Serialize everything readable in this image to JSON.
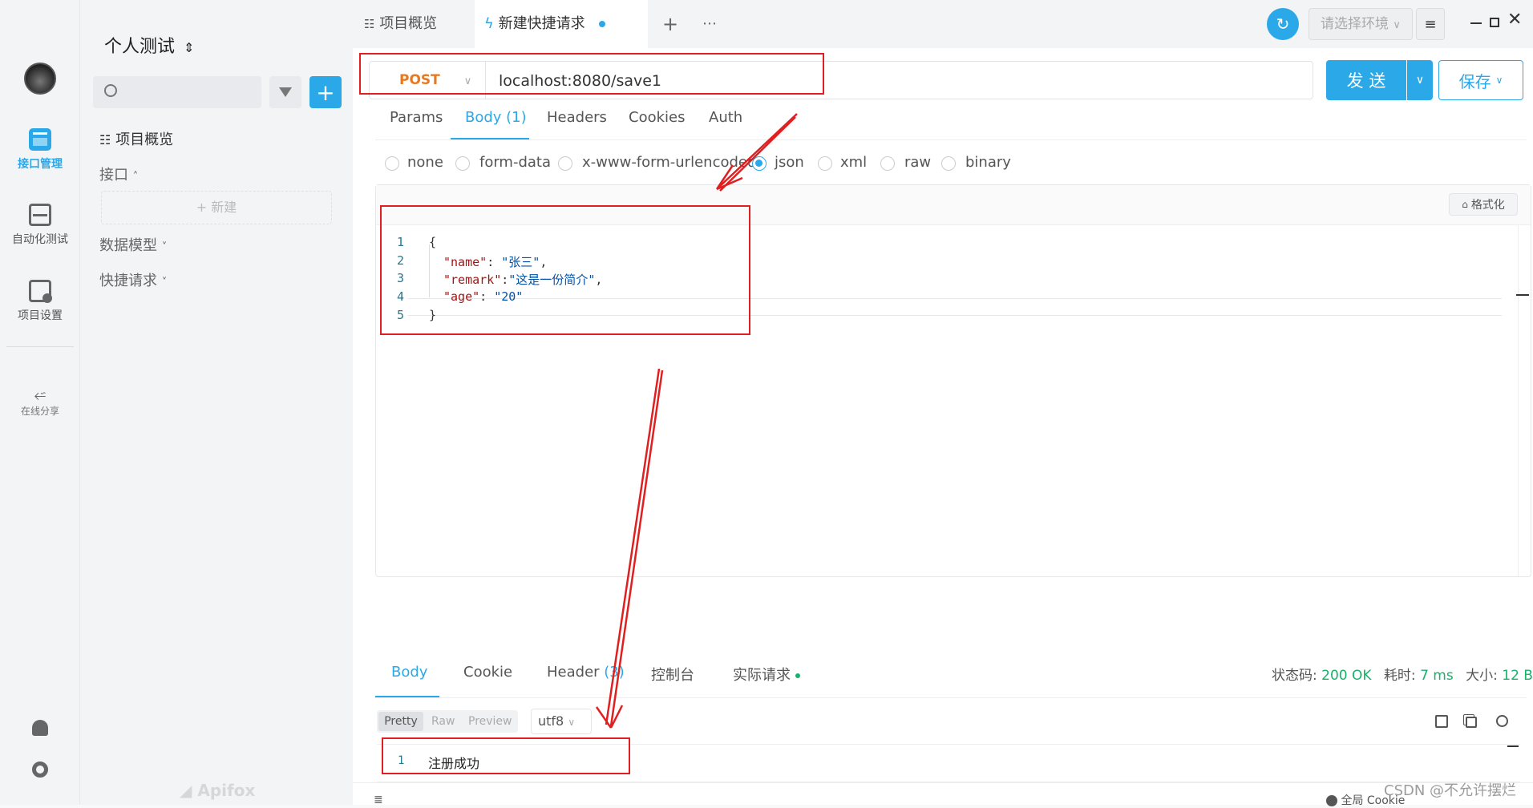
{
  "colors": {
    "accent": "#2ba8e8",
    "post": "#e57a24",
    "success": "#17b26a",
    "annotation": "#e02020"
  },
  "rail": {
    "items": [
      {
        "label": "接口管理",
        "icon": "api-icon",
        "active": true
      },
      {
        "label": "自动化测试",
        "icon": "automation-icon",
        "active": false
      },
      {
        "label": "项目设置",
        "icon": "settings-project-icon",
        "active": false
      },
      {
        "label": "在线分享",
        "icon": "share-icon",
        "active": false
      }
    ]
  },
  "sidebar": {
    "project_name": "个人测试",
    "search_placeholder": "",
    "overview_label": "项目概览",
    "api_label": "接口",
    "new_label": "新建",
    "model_label": "数据模型",
    "quick_label": "快捷请求",
    "brand": "Apifox"
  },
  "tabs": {
    "overview": "项目概览",
    "active": "新建快捷请求",
    "env_placeholder": "请选择环境"
  },
  "request": {
    "method": "POST",
    "url": "localhost:8080/save1",
    "send_label": "发 送",
    "save_label": "保存",
    "subtabs": [
      "Params",
      "Body (1)",
      "Headers",
      "Cookies",
      "Auth"
    ],
    "body_types": [
      "none",
      "form-data",
      "x-www-form-urlencoded",
      "json",
      "xml",
      "raw",
      "binary"
    ],
    "selected_body_type": "json",
    "format_label": "格式化",
    "code_lines": [
      {
        "num": "1",
        "text": "{"
      },
      {
        "num": "2",
        "key": "\"name\"",
        "sep": ": ",
        "val": "\"张三\"",
        "end": ","
      },
      {
        "num": "3",
        "key": "\"remark\"",
        "sep": ":",
        "val": "\"这是一份简介\"",
        "end": ","
      },
      {
        "num": "4",
        "key": "\"age\"",
        "sep": ": ",
        "val": "\"20\"",
        "end": ""
      },
      {
        "num": "5",
        "text": "}"
      }
    ]
  },
  "response": {
    "tabs": [
      "Body",
      "Cookie",
      "Header",
      "控制台",
      "实际请求"
    ],
    "header_count": "(3)",
    "status_label": "状态码:",
    "status_value": "200 OK",
    "time_label": "耗时:",
    "time_value": "7 ms",
    "size_label": "大小:",
    "size_value": "12 B",
    "view_modes": [
      "Pretty",
      "Raw",
      "Preview"
    ],
    "encoding": "utf8",
    "line_num": "1",
    "line_text": "注册成功"
  },
  "footer": {
    "cookie_label": "全局 Cookie",
    "watermark": "CSDN @不允许摆烂"
  }
}
